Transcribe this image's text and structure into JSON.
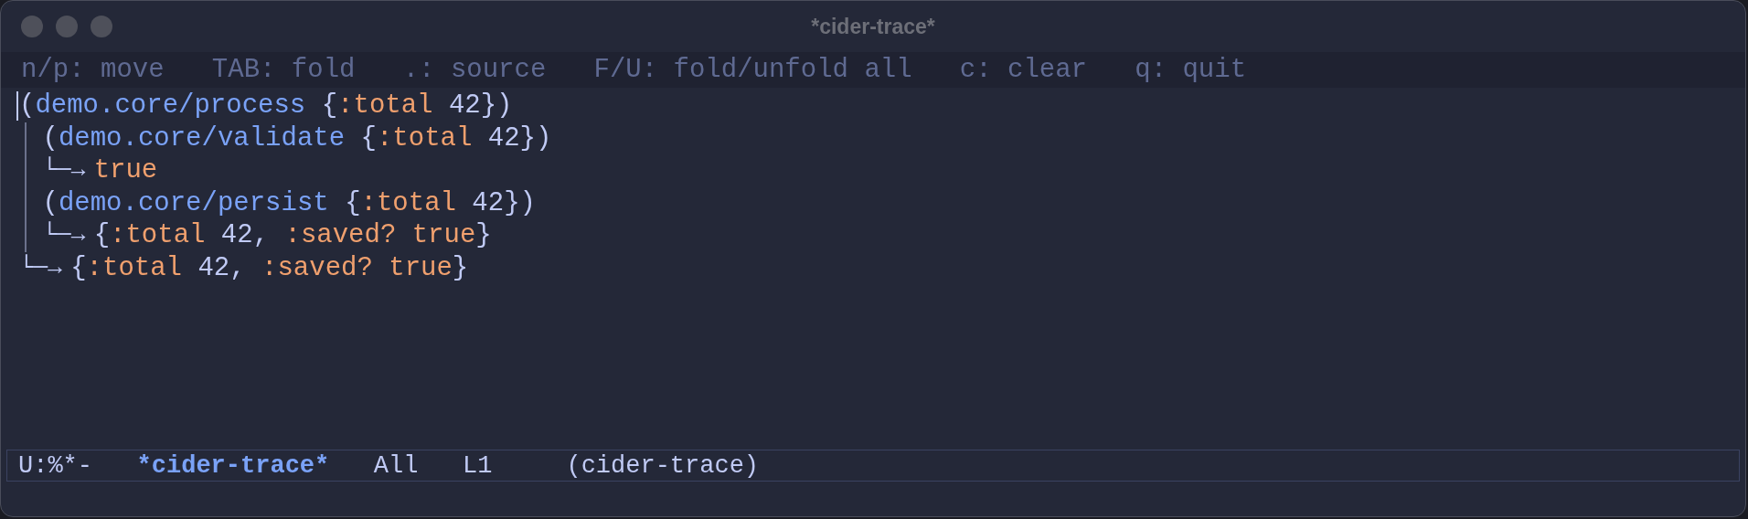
{
  "window": {
    "title": "*cider-trace*"
  },
  "hint_bar": [
    "n/p: move",
    "TAB: fold",
    ".: source",
    "F/U: fold/unfold all",
    "c: clear",
    "q: quit"
  ],
  "trace": [
    {
      "call": [
        {
          "text": "(",
          "kind": "punct"
        },
        {
          "text": "demo.core/process",
          "kind": "fn"
        },
        {
          "text": " {",
          "kind": "punct"
        },
        {
          "text": ":total",
          "kind": "keyword"
        },
        {
          "text": " 42})",
          "kind": "punct"
        }
      ],
      "children": [
        {
          "call": [
            {
              "text": "(",
              "kind": "punct"
            },
            {
              "text": "demo.core/validate",
              "kind": "fn"
            },
            {
              "text": " {",
              "kind": "punct"
            },
            {
              "text": ":total",
              "kind": "keyword"
            },
            {
              "text": " 42})",
              "kind": "punct"
            }
          ],
          "result": {
            "arrow": "└─→",
            "tokens": [
              {
                "text": "true",
                "kind": "keyword"
              }
            ]
          }
        },
        {
          "call": [
            {
              "text": "(",
              "kind": "punct"
            },
            {
              "text": "demo.core/persist",
              "kind": "fn"
            },
            {
              "text": " {",
              "kind": "punct"
            },
            {
              "text": ":total",
              "kind": "keyword"
            },
            {
              "text": " 42})",
              "kind": "punct"
            }
          ],
          "result": {
            "arrow": "└─→",
            "tokens": [
              {
                "text": "{",
                "kind": "punct"
              },
              {
                "text": ":total",
                "kind": "keyword"
              },
              {
                "text": " 42, ",
                "kind": "punct"
              },
              {
                "text": ":saved? true",
                "kind": "keyword"
              },
              {
                "text": "}",
                "kind": "punct"
              }
            ]
          }
        }
      ],
      "result": {
        "arrow": "└─→",
        "tokens": [
          {
            "text": "{",
            "kind": "punct"
          },
          {
            "text": ":total",
            "kind": "keyword"
          },
          {
            "text": " 42, ",
            "kind": "punct"
          },
          {
            "text": ":saved? true",
            "kind": "keyword"
          },
          {
            "text": "}",
            "kind": "punct"
          }
        ]
      }
    }
  ],
  "mode_line": [
    {
      "text": "U:%*-",
      "kind": "plain"
    },
    {
      "text": "*cider-trace*",
      "kind": "buffer"
    },
    {
      "text": "All",
      "kind": "plain"
    },
    {
      "text": "L1",
      "kind": "plain"
    },
    {
      "text": "(cider-trace)",
      "kind": "mode"
    }
  ]
}
